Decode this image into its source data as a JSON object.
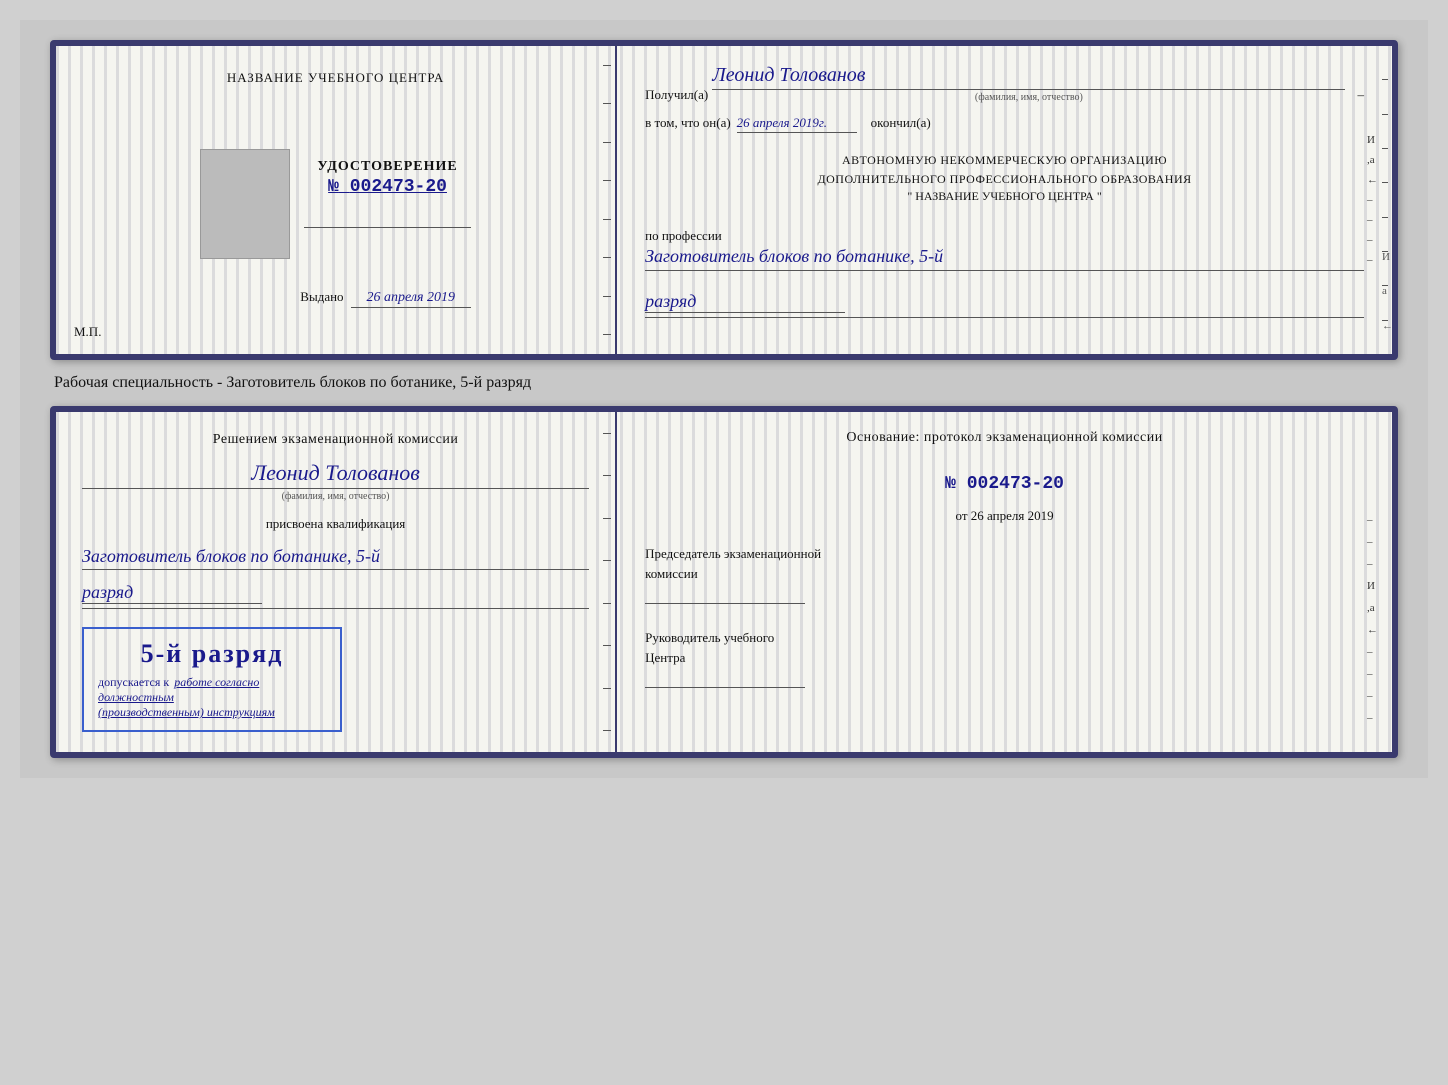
{
  "doc1": {
    "left": {
      "title": "НАЗВАНИЕ УЧЕБНОГО ЦЕНТРА",
      "udostoverenie_label": "УДОСТОВЕРЕНИЕ",
      "doc_number_prefix": "№",
      "doc_number": "002473-20",
      "vydano_label": "Выдано",
      "vydano_date": "26 апреля 2019",
      "mp_label": "М.П."
    },
    "right": {
      "poluchil_prefix": "Получил(а)",
      "poluchil_name": "Леонид Толованов",
      "fio_sub": "(фамилия, имя, отчество)",
      "vtom_prefix": "в том, что он(а)",
      "vtom_date": "26 апреля 2019г.",
      "okonchil": "окончил(а)",
      "org_line1": "АВТОНОМНУЮ НЕКОММЕРЧЕСКУЮ ОРГАНИЗАЦИЮ",
      "org_line2": "ДОПОЛНИТЕЛЬНОГО ПРОФЕССИОНАЛЬНОГО ОБРАЗОВАНИЯ",
      "org_name": "\"  НАЗВАНИЕ УЧЕБНОГО ЦЕНТРА  \"",
      "po_professii": "по профессии",
      "profession": "Заготовитель блоков по ботанике, 5-й",
      "razryad": "разряд"
    }
  },
  "subtitle": "Рабочая специальность - Заготовитель блоков по ботанике, 5-й разряд",
  "doc2": {
    "left": {
      "resheniem": "Решением экзаменационной комиссии",
      "person_name": "Леонид Толованов",
      "fio_sub": "(фамилия, имя, отчество)",
      "prisvoena": "присвоена квалификация",
      "qualification": "Заготовитель блоков по ботанике, 5-й",
      "razryad": "разряд",
      "stamp_text": "5-й разряд",
      "dopuskaetsya": "допускается к",
      "rabote": "работе согласно должностным",
      "instruktsiyam": "(производственным) инструкциям"
    },
    "right": {
      "osnovanie": "Основание: протокол экзаменационной комиссии",
      "number_prefix": "№",
      "number": "002473-20",
      "ot_prefix": "от",
      "ot_date": "26 апреля 2019",
      "predsedatel_line1": "Председатель экзаменационной",
      "predsedatel_line2": "комиссии",
      "rukovoditel_line1": "Руководитель учебного",
      "rukovoditel_line2": "Центра"
    }
  }
}
